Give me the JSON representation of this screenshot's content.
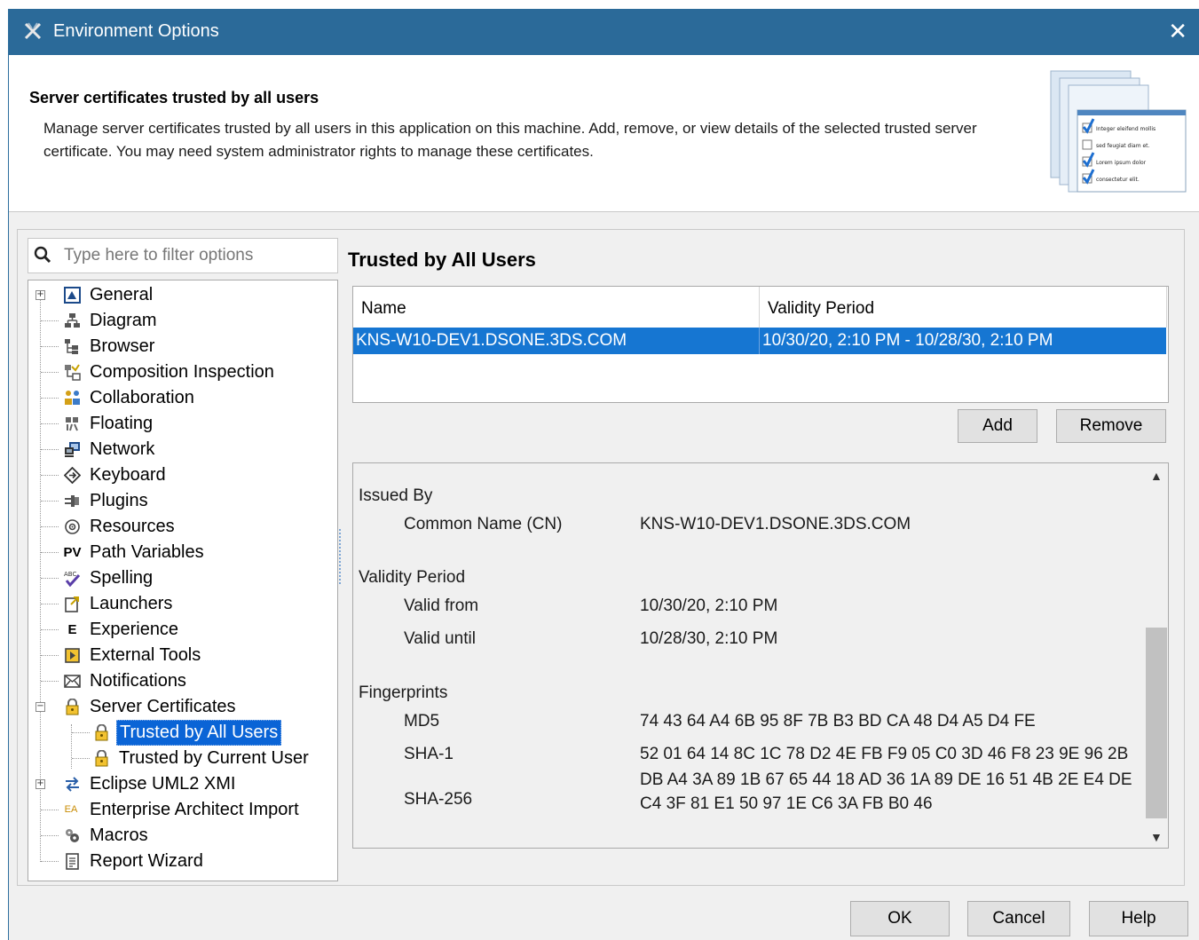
{
  "window": {
    "title": "Environment Options",
    "close_glyph": "✕"
  },
  "header": {
    "title": "Server certificates trusted by all users",
    "description": "Manage server certificates trusted by all users in this application on this machine. Add, remove, or view details of the selected trusted server certificate. You may need system administrator rights to manage these certificates.",
    "image_items": [
      "Integer eleifend mollis",
      "sed feugiat diam et.",
      "Lorem ipsum dolor",
      "consectetur elit."
    ]
  },
  "filter": {
    "placeholder": "Type here to filter options"
  },
  "tree": {
    "items": [
      {
        "label": "General",
        "icon": "general-icon"
      },
      {
        "label": "Diagram",
        "icon": "diagram-icon"
      },
      {
        "label": "Browser",
        "icon": "browser-icon"
      },
      {
        "label": "Composition Inspection",
        "icon": "composition-icon"
      },
      {
        "label": "Collaboration",
        "icon": "collaboration-icon"
      },
      {
        "label": "Floating",
        "icon": "floating-icon"
      },
      {
        "label": "Network",
        "icon": "network-icon"
      },
      {
        "label": "Keyboard",
        "icon": "keyboard-icon"
      },
      {
        "label": "Plugins",
        "icon": "plugins-icon"
      },
      {
        "label": "Resources",
        "icon": "resources-icon"
      },
      {
        "label": "Path Variables",
        "icon": "path-variables-icon",
        "glyph": "PV"
      },
      {
        "label": "Spelling",
        "icon": "spelling-icon"
      },
      {
        "label": "Launchers",
        "icon": "launchers-icon"
      },
      {
        "label": "Experience",
        "icon": "experience-icon",
        "glyph": "E"
      },
      {
        "label": "External Tools",
        "icon": "external-tools-icon"
      },
      {
        "label": "Notifications",
        "icon": "notifications-icon"
      },
      {
        "label": "Server Certificates",
        "icon": "lock-icon"
      },
      {
        "label": "Trusted by All Users",
        "icon": "lock-icon",
        "selected": true
      },
      {
        "label": "Trusted by Current User",
        "icon": "lock-icon"
      },
      {
        "label": "Eclipse UML2 XMI",
        "icon": "eclipse-icon"
      },
      {
        "label": "Enterprise Architect Import",
        "icon": "ea-icon",
        "glyph": "EA"
      },
      {
        "label": "Macros",
        "icon": "macros-icon"
      },
      {
        "label": "Report Wizard",
        "icon": "report-wizard-icon"
      }
    ]
  },
  "trusted": {
    "title": "Trusted by All Users",
    "columns": [
      "Name",
      "Validity Period"
    ],
    "rows": [
      {
        "name": "KNS-W10-DEV1.DSONE.3DS.COM",
        "validity": "10/30/20, 2:10 PM - 10/28/30, 2:10 PM"
      }
    ],
    "add_label": "Add",
    "remove_label": "Remove",
    "splitter": "........."
  },
  "details": {
    "issued_by": "Issued By",
    "cn_label": "Common Name (CN)",
    "cn_value": "KNS-W10-DEV1.DSONE.3DS.COM",
    "validity_period": "Validity Period",
    "valid_from_label": "Valid from",
    "valid_from": "10/30/20, 2:10 PM",
    "valid_until_label": "Valid until",
    "valid_until": "10/28/30, 2:10 PM",
    "fingerprints": "Fingerprints",
    "md5_label": "MD5",
    "md5": "74 43 64 A4 6B 95 8F 7B B3 BD CA 48 D4 A5 D4 FE",
    "sha1_label": "SHA-1",
    "sha1": "52 01 64 14 8C 1C 78 D2 4E FB F9 05 C0 3D 46 F8 23 9E 96 2B",
    "sha256_label": "SHA-256",
    "sha256_line1": "DB A4 3A 89 1B 67 65 44 18 AD 36 1A 89 DE 16 51 4B 2E E4 DE",
    "sha256_line2": "C4 3F 81 E1 50 97 1E C6 3A FB B0 46"
  },
  "footer": {
    "ok": "OK",
    "cancel": "Cancel",
    "help": "Help"
  }
}
